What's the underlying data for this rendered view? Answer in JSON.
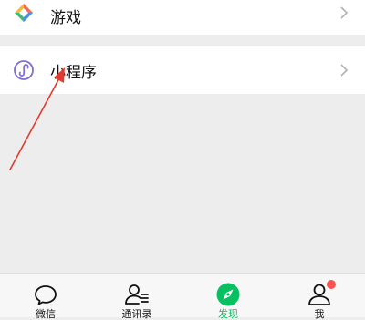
{
  "menu": {
    "games": {
      "label": "游戏",
      "icon": "games-diamond-icon"
    },
    "mini_programs": {
      "label": "小程序",
      "icon": "mini-program-icon"
    }
  },
  "tabbar": {
    "active_color": "#07c160",
    "badge_color": "#fa5151",
    "tabs": [
      {
        "label": "微信",
        "icon": "chat-bubble-icon",
        "active": false
      },
      {
        "label": "通讯录",
        "icon": "contacts-icon",
        "active": false
      },
      {
        "label": "发现",
        "icon": "discover-compass-icon",
        "active": true
      },
      {
        "label": "我",
        "icon": "me-person-icon",
        "active": false,
        "badge": true
      }
    ]
  },
  "annotation": {
    "color": "#e23b2e"
  }
}
